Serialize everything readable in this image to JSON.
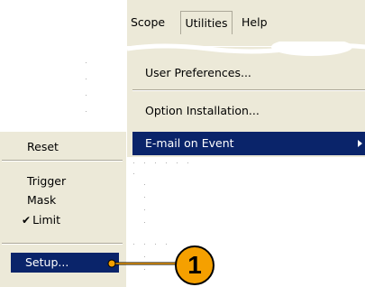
{
  "menubar": {
    "scope_label": "Scope",
    "utilities_label": "Utilities",
    "help_label": "Help"
  },
  "utilities_menu": {
    "items": [
      {
        "label": "User Preferences..."
      },
      {
        "label": "Option Installation..."
      },
      {
        "label": "E-mail on Event"
      }
    ]
  },
  "sidebar": {
    "reset_label": "Reset",
    "trigger_label": "Trigger",
    "mask_label": "Mask",
    "limit_label": "Limit",
    "setup_label": "Setup..."
  },
  "callout": {
    "number": "1"
  },
  "colors": {
    "menu_bg": "#ece9d8",
    "highlight": "#0a246a",
    "callout": "#f5a000"
  }
}
